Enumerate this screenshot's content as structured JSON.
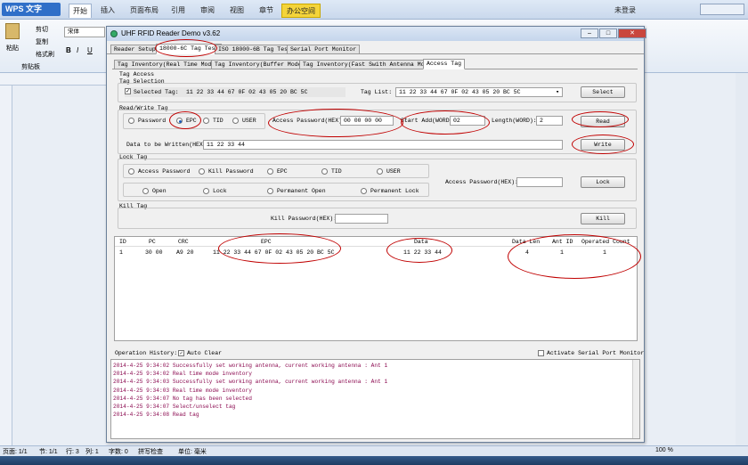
{
  "wps": {
    "app_title": "WPS 文字",
    "tabs": [
      "开始",
      "插入",
      "页面布局",
      "引用",
      "审阅",
      "视图",
      "章节",
      "办公空间"
    ],
    "login": "未登录",
    "ribbon": {
      "cut": "剪切",
      "copy": "复制",
      "paste": "粘贴",
      "format_painter": "格式刷",
      "clipboard_group": "剪贴板",
      "font_name": "宋体"
    },
    "status": {
      "page": "页面: 1/1",
      "section": "节: 1/1",
      "row": "行: 3",
      "col": "列: 1",
      "words": "字数: 0",
      "spell": "拼写检查",
      "unit": "单位: 毫米",
      "zoom": "100 %"
    }
  },
  "dialog": {
    "title": "UHF RFID Reader Demo v3.62",
    "main_tabs": [
      "Reader Setup",
      "18000-6C Tag Test",
      "ISO 18000-6B Tag Test",
      "Serial Port Monitor"
    ],
    "sub_tabs": [
      "Tag Inventory(Real Time Mode)",
      "Tag Inventory(Buffer Mode)",
      "Tag Inventory(Fast Swith Antenna Mode)",
      "Access Tag"
    ],
    "access_tag_label": "Tag Access",
    "tag_selection": {
      "title": "Tag Selection",
      "selected_label": "Selected Tag:",
      "selected_value": "11 22 33 44 67 0F 02 43 05 20 BC 5C",
      "tag_list_label": "Tag List:",
      "tag_list_value": "11 22 33 44 67 0F 02 43 05 20 BC 5C",
      "select_button": "Select"
    },
    "read_write": {
      "title": "Read/Write Tag",
      "banks": [
        "Password",
        "EPC",
        "TID",
        "USER"
      ],
      "selected_bank": "EPC",
      "access_pwd_label": "Access Password(HEX):",
      "access_pwd_value": "00 00 00 00",
      "start_add_label": "Start Add(WORD):",
      "start_add_value": "02",
      "length_label": "Length(WORD):",
      "length_value": "2",
      "read_button": "Read",
      "write_data_label": "Data to be Written(HEX):",
      "write_data_value": "11 22 33 44",
      "write_button": "Write"
    },
    "lock": {
      "title": "Lock Tag",
      "targets": [
        "Access Password",
        "Kill Password",
        "EPC",
        "TID",
        "USER"
      ],
      "actions": [
        "Open",
        "Lock",
        "Permanent Open",
        "Permanent Lock"
      ],
      "access_pwd_label": "Access Password(HEX):",
      "lock_button": "Lock"
    },
    "kill": {
      "title": "Kill Tag",
      "kill_pwd_label": "Kill Password(HEX):",
      "kill_button": "Kill"
    },
    "table": {
      "headers": [
        "ID",
        "PC",
        "CRC",
        "EPC",
        "Data",
        "Data Len",
        "Ant ID",
        "Operated Count"
      ],
      "rows": [
        {
          "id": "1",
          "pc": "30 00",
          "crc": "A9 20",
          "epc": "11 22 33 44 67 0F 02 43 05 20 BC 5C",
          "data": "11 22 33 44",
          "len": "4",
          "ant": "1",
          "count": "1"
        }
      ]
    },
    "operation": {
      "history_label": "Operation History:",
      "auto_clear": "Auto Clear",
      "activate_monitor": "Activate Serial Port Monitor",
      "logs": [
        "2014-4-25 9:34:02 Successfully set working antenna, current working antenna : Ant 1",
        "2014-4-25 9:34:02 Real time mode inventory",
        "2014-4-25 9:34:03 Successfully set working antenna, current working antenna : Ant 1",
        "2014-4-25 9:34:03 Real time mode inventory",
        "2014-4-25 9:34:07 No tag has been selected",
        "2014-4-25 9:34:07 Select/unselect tag",
        "2014-4-25 9:34:08 Read tag"
      ]
    }
  },
  "colors": {
    "annotation": "#c00000",
    "log_text": "#8b0a50",
    "wps_blue": "#2f6fc8"
  }
}
